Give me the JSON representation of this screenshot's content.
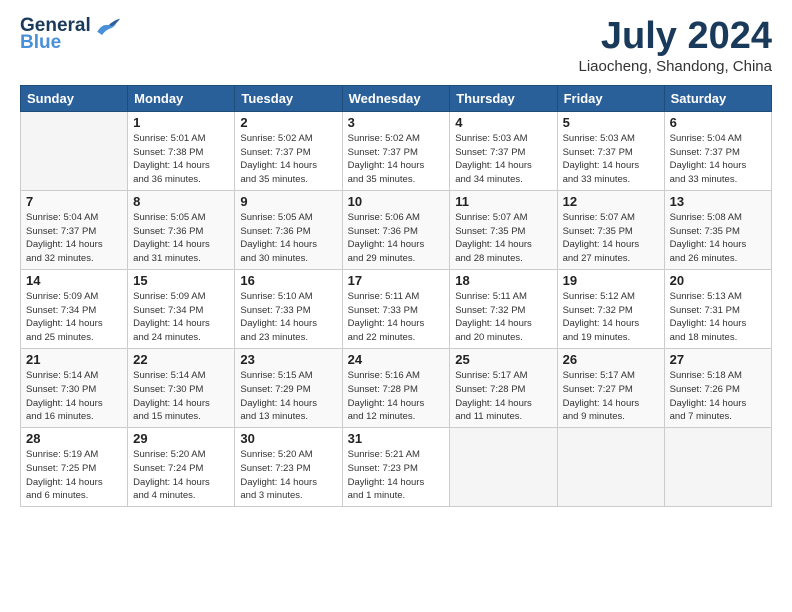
{
  "logo": {
    "line1": "General",
    "line2": "Blue"
  },
  "header": {
    "month_year": "July 2024",
    "location": "Liaocheng, Shandong, China"
  },
  "weekdays": [
    "Sunday",
    "Monday",
    "Tuesday",
    "Wednesday",
    "Thursday",
    "Friday",
    "Saturday"
  ],
  "weeks": [
    [
      {
        "day": "",
        "info": ""
      },
      {
        "day": "1",
        "info": "Sunrise: 5:01 AM\nSunset: 7:38 PM\nDaylight: 14 hours\nand 36 minutes."
      },
      {
        "day": "2",
        "info": "Sunrise: 5:02 AM\nSunset: 7:37 PM\nDaylight: 14 hours\nand 35 minutes."
      },
      {
        "day": "3",
        "info": "Sunrise: 5:02 AM\nSunset: 7:37 PM\nDaylight: 14 hours\nand 35 minutes."
      },
      {
        "day": "4",
        "info": "Sunrise: 5:03 AM\nSunset: 7:37 PM\nDaylight: 14 hours\nand 34 minutes."
      },
      {
        "day": "5",
        "info": "Sunrise: 5:03 AM\nSunset: 7:37 PM\nDaylight: 14 hours\nand 33 minutes."
      },
      {
        "day": "6",
        "info": "Sunrise: 5:04 AM\nSunset: 7:37 PM\nDaylight: 14 hours\nand 33 minutes."
      }
    ],
    [
      {
        "day": "7",
        "info": "Sunrise: 5:04 AM\nSunset: 7:37 PM\nDaylight: 14 hours\nand 32 minutes."
      },
      {
        "day": "8",
        "info": "Sunrise: 5:05 AM\nSunset: 7:36 PM\nDaylight: 14 hours\nand 31 minutes."
      },
      {
        "day": "9",
        "info": "Sunrise: 5:05 AM\nSunset: 7:36 PM\nDaylight: 14 hours\nand 30 minutes."
      },
      {
        "day": "10",
        "info": "Sunrise: 5:06 AM\nSunset: 7:36 PM\nDaylight: 14 hours\nand 29 minutes."
      },
      {
        "day": "11",
        "info": "Sunrise: 5:07 AM\nSunset: 7:35 PM\nDaylight: 14 hours\nand 28 minutes."
      },
      {
        "day": "12",
        "info": "Sunrise: 5:07 AM\nSunset: 7:35 PM\nDaylight: 14 hours\nand 27 minutes."
      },
      {
        "day": "13",
        "info": "Sunrise: 5:08 AM\nSunset: 7:35 PM\nDaylight: 14 hours\nand 26 minutes."
      }
    ],
    [
      {
        "day": "14",
        "info": "Sunrise: 5:09 AM\nSunset: 7:34 PM\nDaylight: 14 hours\nand 25 minutes."
      },
      {
        "day": "15",
        "info": "Sunrise: 5:09 AM\nSunset: 7:34 PM\nDaylight: 14 hours\nand 24 minutes."
      },
      {
        "day": "16",
        "info": "Sunrise: 5:10 AM\nSunset: 7:33 PM\nDaylight: 14 hours\nand 23 minutes."
      },
      {
        "day": "17",
        "info": "Sunrise: 5:11 AM\nSunset: 7:33 PM\nDaylight: 14 hours\nand 22 minutes."
      },
      {
        "day": "18",
        "info": "Sunrise: 5:11 AM\nSunset: 7:32 PM\nDaylight: 14 hours\nand 20 minutes."
      },
      {
        "day": "19",
        "info": "Sunrise: 5:12 AM\nSunset: 7:32 PM\nDaylight: 14 hours\nand 19 minutes."
      },
      {
        "day": "20",
        "info": "Sunrise: 5:13 AM\nSunset: 7:31 PM\nDaylight: 14 hours\nand 18 minutes."
      }
    ],
    [
      {
        "day": "21",
        "info": "Sunrise: 5:14 AM\nSunset: 7:30 PM\nDaylight: 14 hours\nand 16 minutes."
      },
      {
        "day": "22",
        "info": "Sunrise: 5:14 AM\nSunset: 7:30 PM\nDaylight: 14 hours\nand 15 minutes."
      },
      {
        "day": "23",
        "info": "Sunrise: 5:15 AM\nSunset: 7:29 PM\nDaylight: 14 hours\nand 13 minutes."
      },
      {
        "day": "24",
        "info": "Sunrise: 5:16 AM\nSunset: 7:28 PM\nDaylight: 14 hours\nand 12 minutes."
      },
      {
        "day": "25",
        "info": "Sunrise: 5:17 AM\nSunset: 7:28 PM\nDaylight: 14 hours\nand 11 minutes."
      },
      {
        "day": "26",
        "info": "Sunrise: 5:17 AM\nSunset: 7:27 PM\nDaylight: 14 hours\nand 9 minutes."
      },
      {
        "day": "27",
        "info": "Sunrise: 5:18 AM\nSunset: 7:26 PM\nDaylight: 14 hours\nand 7 minutes."
      }
    ],
    [
      {
        "day": "28",
        "info": "Sunrise: 5:19 AM\nSunset: 7:25 PM\nDaylight: 14 hours\nand 6 minutes."
      },
      {
        "day": "29",
        "info": "Sunrise: 5:20 AM\nSunset: 7:24 PM\nDaylight: 14 hours\nand 4 minutes."
      },
      {
        "day": "30",
        "info": "Sunrise: 5:20 AM\nSunset: 7:23 PM\nDaylight: 14 hours\nand 3 minutes."
      },
      {
        "day": "31",
        "info": "Sunrise: 5:21 AM\nSunset: 7:23 PM\nDaylight: 14 hours\nand 1 minute."
      },
      {
        "day": "",
        "info": ""
      },
      {
        "day": "",
        "info": ""
      },
      {
        "day": "",
        "info": ""
      }
    ]
  ]
}
